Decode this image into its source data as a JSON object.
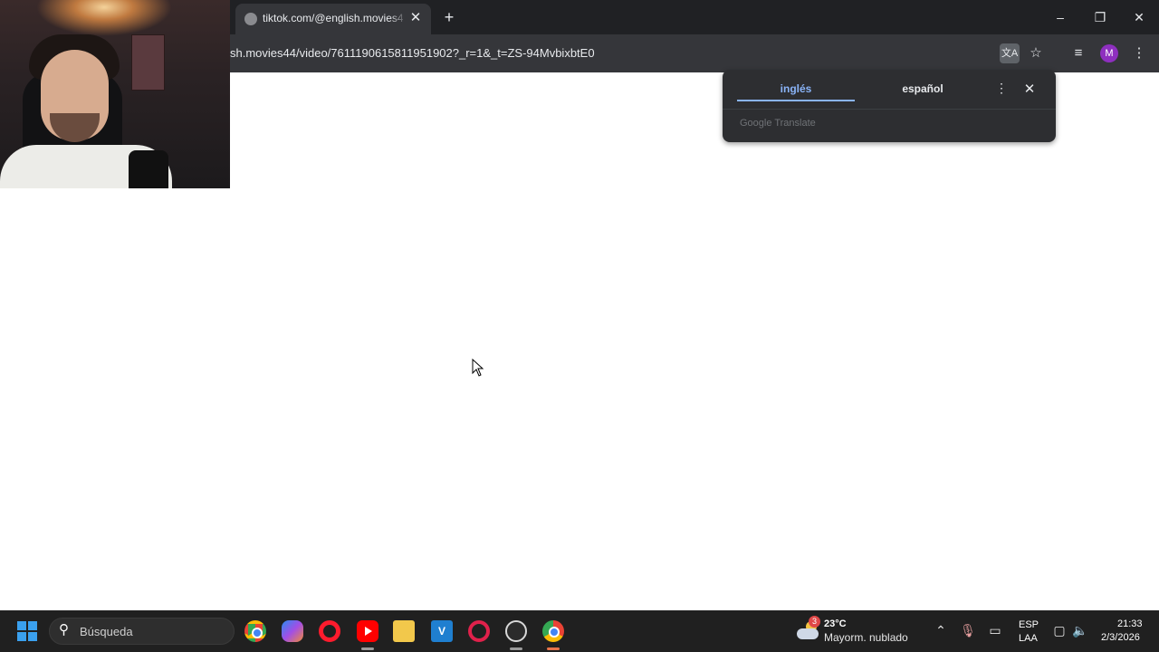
{
  "browser": {
    "tab": {
      "title": "tiktok.com/@english.movies44/"
    },
    "url": "sh.movies44/video/7611190615811951902?_r=1&_t=ZS-94MvbixbtE0",
    "profile_initial": "M",
    "icons": {
      "tab_favicon": "globe-icon",
      "tab_close": "close-icon",
      "new_tab": "plus-icon",
      "translate": "translate-icon",
      "bookmark": "star-icon",
      "media": "media-queue-icon",
      "menu": "kebab-menu-icon"
    }
  },
  "window_controls": {
    "minimize": "–",
    "restore": "❐",
    "close": "✕"
  },
  "translate_popup": {
    "source_language": "inglés",
    "target_language": "español",
    "brand": "Google Translate",
    "accent_color": "#8ab4f8"
  },
  "taskbar": {
    "search_placeholder": "Búsqueda",
    "apps": [
      {
        "name": "chrome",
        "icon": "chrome-icon"
      },
      {
        "name": "copilot",
        "icon": "copilot-icon"
      },
      {
        "name": "opera",
        "icon": "opera-icon"
      },
      {
        "name": "youtube",
        "icon": "youtube-icon"
      },
      {
        "name": "file-explorer",
        "icon": "folder-icon"
      },
      {
        "name": "v-app",
        "icon": "v-icon",
        "label": "V"
      },
      {
        "name": "opera-gx",
        "icon": "opera-gx-icon"
      },
      {
        "name": "obs",
        "icon": "obs-icon"
      },
      {
        "name": "chrome-profile",
        "icon": "chrome-profile-icon"
      }
    ],
    "weather": {
      "temperature": "23°C",
      "description": "Mayorm. nublado",
      "badge": "3"
    },
    "language": {
      "top": "ESP",
      "bottom": "LAA"
    },
    "clock": {
      "time": "21:33",
      "date": "2/3/2026"
    }
  }
}
